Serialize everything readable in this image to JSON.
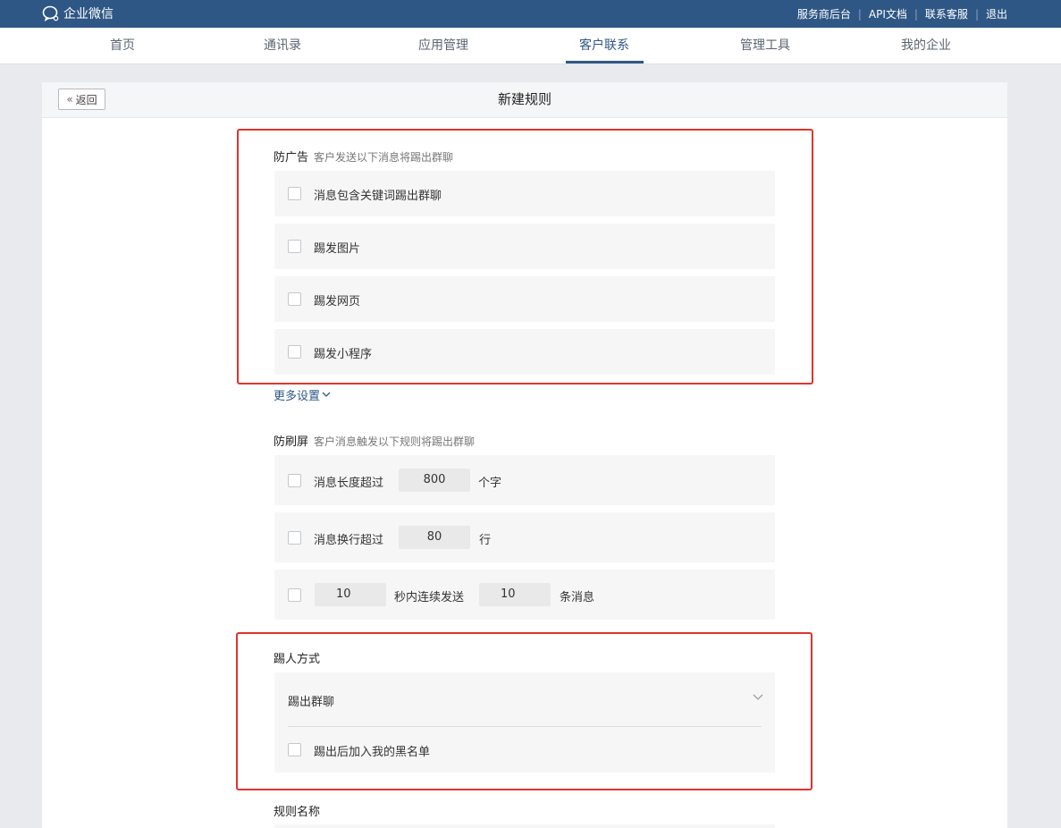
{
  "app": {
    "logo_text": "企业微信",
    "top_links": [
      "服务商后台",
      "API文档",
      "联系客服",
      "退出"
    ]
  },
  "nav": {
    "items": [
      "首页",
      "通讯录",
      "应用管理",
      "客户联系",
      "管理工具",
      "我的企业"
    ],
    "active": "客户联系"
  },
  "page": {
    "back_label": "返回",
    "title": "新建规则"
  },
  "anti_ad": {
    "title": "防广告",
    "hint": "客户发送以下消息将踢出群聊",
    "options": [
      {
        "label": "消息包含关键词踢出群聊",
        "checked": false
      },
      {
        "label": "踢发图片",
        "checked": false
      },
      {
        "label": "踢发网页",
        "checked": false
      },
      {
        "label": "踢发小程序",
        "checked": false
      }
    ],
    "more_label": "更多设置"
  },
  "anti_spam": {
    "title": "防刷屏",
    "hint": "客户消息触发以下规则将踢出群聊",
    "length": {
      "prefix": "消息长度超过",
      "value": "800",
      "suffix": "个字"
    },
    "lines": {
      "prefix": "消息换行超过",
      "value": "80",
      "suffix": "行"
    },
    "rate": {
      "seconds": "10",
      "middle": "秒内连续发送",
      "count": "10",
      "suffix": "条消息"
    }
  },
  "kick": {
    "title": "踢人方式",
    "selected": "踢出群聊",
    "blacklist_label": "踢出后加入我的黑名单"
  },
  "rule_name": {
    "label": "规则名称"
  },
  "colors": {
    "brand": "#2f5785",
    "highlight": "#e0332b"
  }
}
